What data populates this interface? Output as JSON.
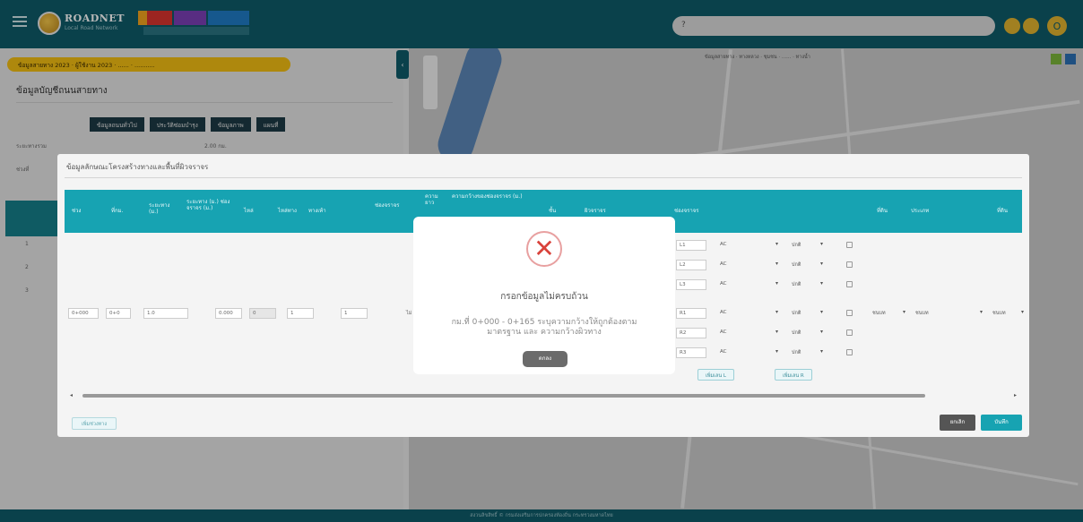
{
  "header": {
    "brand": "ROADNET",
    "brand_sub": "Local Road Network",
    "search_placeholder": "?",
    "user_initial": "O"
  },
  "left_panel": {
    "info_pill": "ข้อมูลสายทาง 2023 · ผู้ใช้งาน 2023 · ...... · ...........",
    "title": "ข้อมูลบัญชีถนนสายทาง",
    "buttons": [
      "ข้อมูลถนนทั่วไป",
      "ประวัติซ่อมบำรุง",
      "ข้อมูลภาพ",
      "แผนที่"
    ],
    "row_label_1": "ระยะทางรวม",
    "row_value_1": "2.00 กม.",
    "row_label_2": "ช่วงที่",
    "list_items": [
      "1",
      "2",
      "3"
    ]
  },
  "map": {
    "legend": "ข้อมูลสายทาง · ทางหลวง · ชุมชน · ...... · ทางน้ำ"
  },
  "dialog": {
    "title": "ข้อมูลลักษณะโครงสร้างทางและพื้นที่ผิวจราจร",
    "headers": {
      "h1": "ช่วง",
      "h2": "ที่กม.",
      "h3": "ระยะทาง (ม.)",
      "h4": "ระยะทาง (ม.) ช่องจราจร (ม.)",
      "h5": "ไหล่",
      "h6": "ไหล่ทาง",
      "h7": "ทางเท้า",
      "h8": "ช่องจราจร",
      "h9": "ความยาว",
      "h10": "ความกว้างของช่องจราจร (ม.)",
      "h11": "ชั้น",
      "h12": "ผิวจราจร",
      "h13": "ช่องจราจร",
      "h14": "ที่ดิน",
      "h15": "ประเภท",
      "h16": "ที่ดิน"
    },
    "row_values": {
      "v1": "0+000",
      "v2": "0+0",
      "v3": "1.0",
      "v4": "0.000",
      "v5": "0",
      "v6": "1",
      "v7": "1",
      "v8": "ไม่"
    },
    "lanes": [
      {
        "code": "L1",
        "surface": "AC",
        "status": "ปกติ"
      },
      {
        "code": "L2",
        "surface": "AC",
        "status": "ปกติ"
      },
      {
        "code": "L3",
        "surface": "AC",
        "status": "ปกติ"
      },
      {
        "code": "R1",
        "surface": "AC",
        "status": "ปกติ"
      },
      {
        "code": "R2",
        "surface": "AC",
        "status": "ปกติ"
      },
      {
        "code": "R3",
        "surface": "AC",
        "status": "ปกติ"
      }
    ],
    "right_selects": {
      "s1": "ชนบท",
      "s2": "ชนบท",
      "s3": "ชนบท"
    },
    "add_lane_left": "เพิ่มเลน L",
    "add_lane_right": "เพิ่มเลน R",
    "add_section": "เพิ่มช่วงทาง",
    "cancel": "ยกเลิก",
    "save": "บันทึก"
  },
  "alert": {
    "icon": "close-icon",
    "title": "กรอกข้อมูลไม่ครบถ้วน",
    "message": "กม.ที่ 0+000 - 0+165 ระบุความกว้างให้ถูกต้องตามมาตรฐาน และ ความกว้างผิวทาง",
    "button": "ตกลง"
  },
  "footer": {
    "text": "สงวนลิขสิทธิ์ © กรมส่งเสริมการปกครองท้องถิ่น กระทรวงมหาดไทย"
  }
}
